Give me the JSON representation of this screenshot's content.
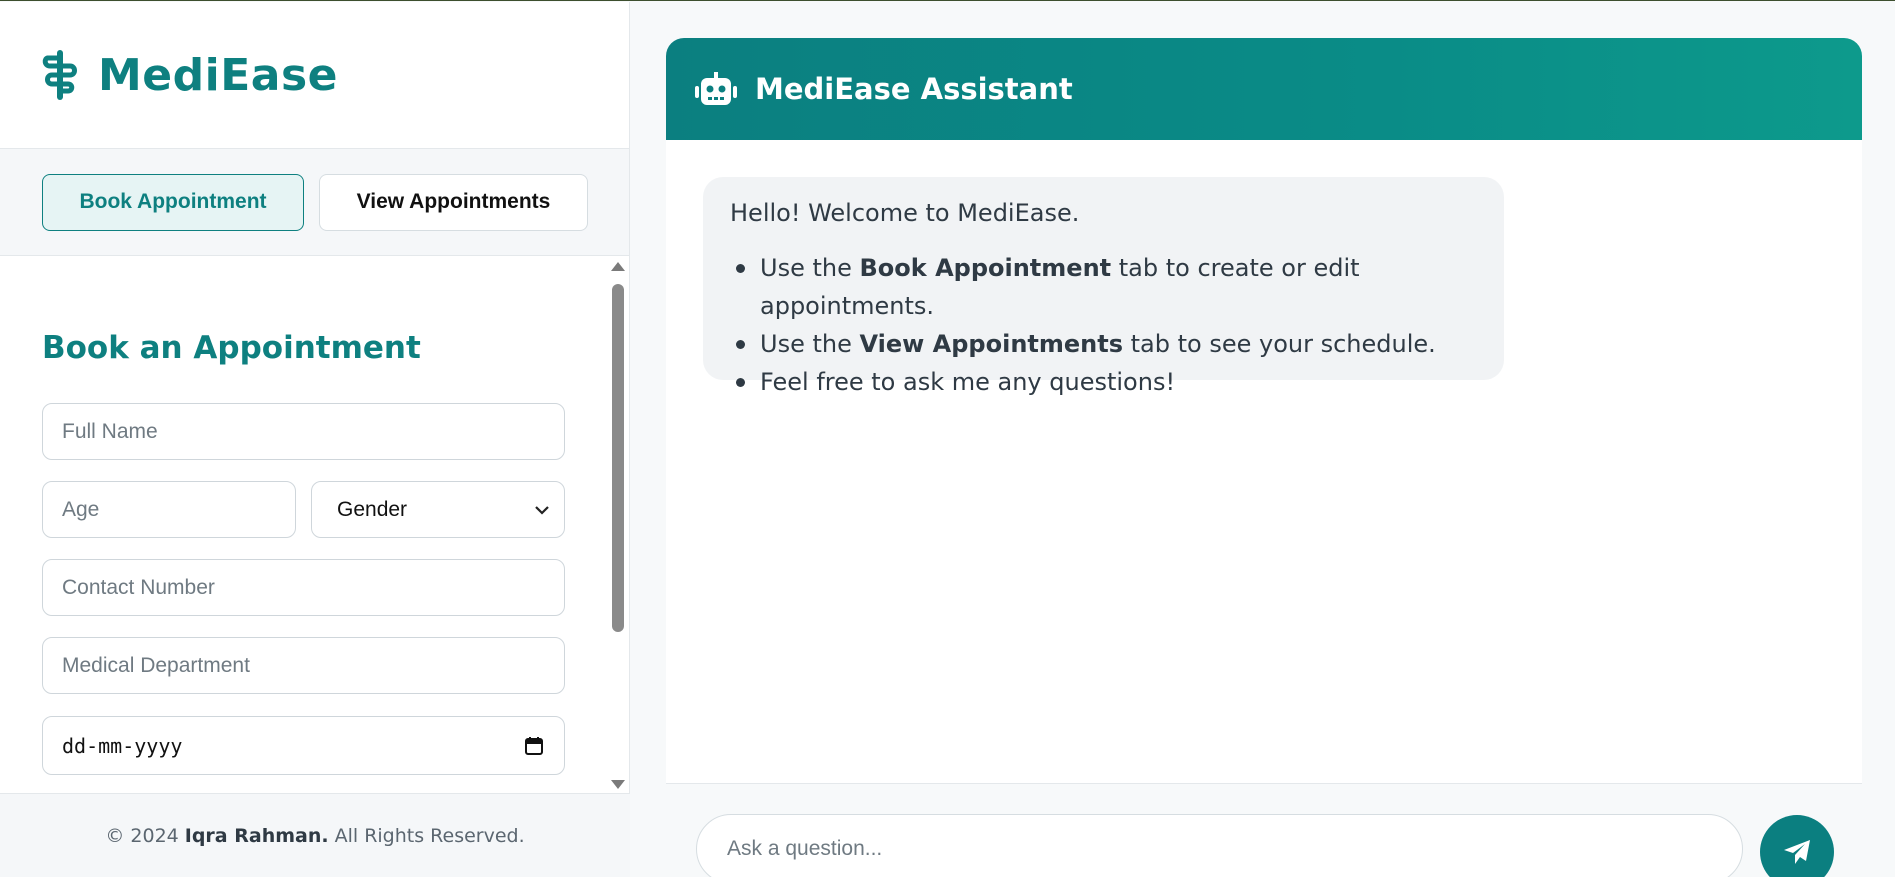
{
  "brand": {
    "name": "MediEase",
    "icon": "caduceus-icon"
  },
  "tabs": [
    {
      "label": "Book Appointment",
      "active": true
    },
    {
      "label": "View Appointments",
      "active": false
    }
  ],
  "form": {
    "title": "Book an Appointment",
    "full_name_placeholder": "Full Name",
    "age_placeholder": "Age",
    "gender_selected": "Gender",
    "contact_placeholder": "Contact Number",
    "department_placeholder": "Medical Department",
    "date_placeholder": "dd-mm-yyyy"
  },
  "footer": {
    "prefix": "© 2024",
    "author": "Iqra Rahman.",
    "suffix": "All Rights Reserved."
  },
  "chat": {
    "title": "MediEase Assistant",
    "header_icon": "robot-icon",
    "message": {
      "greeting": "Hello! Welcome to MediEase.",
      "items": [
        {
          "pre": "Use the ",
          "bold": "Book Appointment",
          "post": " tab to create or edit appointments."
        },
        {
          "pre": "Use the ",
          "bold": "View Appointments",
          "post": " tab to see your schedule."
        },
        {
          "pre": "Feel free to ask me any questions!",
          "bold": "",
          "post": ""
        }
      ]
    },
    "input_placeholder": "Ask a question...",
    "send_icon": "paper-plane-icon"
  },
  "colors": {
    "accent": "#0e8080",
    "accent_light": "#e6f4f4",
    "bubble": "#f1f3f5"
  }
}
